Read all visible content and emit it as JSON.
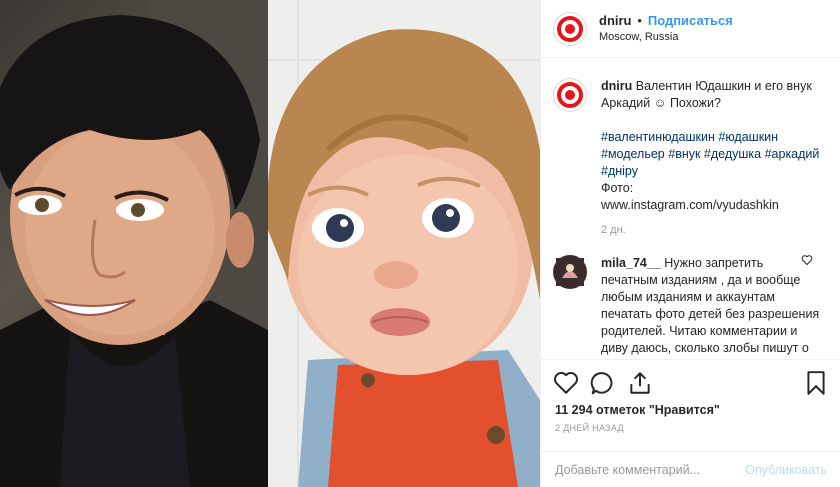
{
  "post": {
    "username": "dniru",
    "follow_label": "Подписаться",
    "dot": "•",
    "location": "Moscow, Russia"
  },
  "caption": {
    "username": "dniru",
    "text": "Валентин Юдашкин и его внук Аркадий ☺ Похожи?",
    "hashtags": "#валентинюдашкин #юдашкин #модельер #внук #дедушка #аркадий #днiру",
    "photo_credit_label": "Фото:",
    "photo_credit_url": "www.instagram.com/vyudashkin",
    "time": "2 дн."
  },
  "comment": {
    "username": "mila_74__",
    "text": "Нужно запретить печатным изданиям , да и вообще любым изданиям и аккаунтам печатать фото детей без разрешения родителей. Читаю комментарии и диву даюсь, сколько злобы пишут о"
  },
  "actions": {
    "likes": "11 294 отметок \"Нравится\"",
    "posted": "2 ДНЕЙ НАЗАД"
  },
  "add_comment": {
    "placeholder": "Добавьте комментарий...",
    "publish_label": "Опубликовать"
  },
  "colors": {
    "accent": "#3897f0",
    "brand_red": "#e4161b",
    "muted": "#999999",
    "publish_disabled": "#b2dffc"
  }
}
